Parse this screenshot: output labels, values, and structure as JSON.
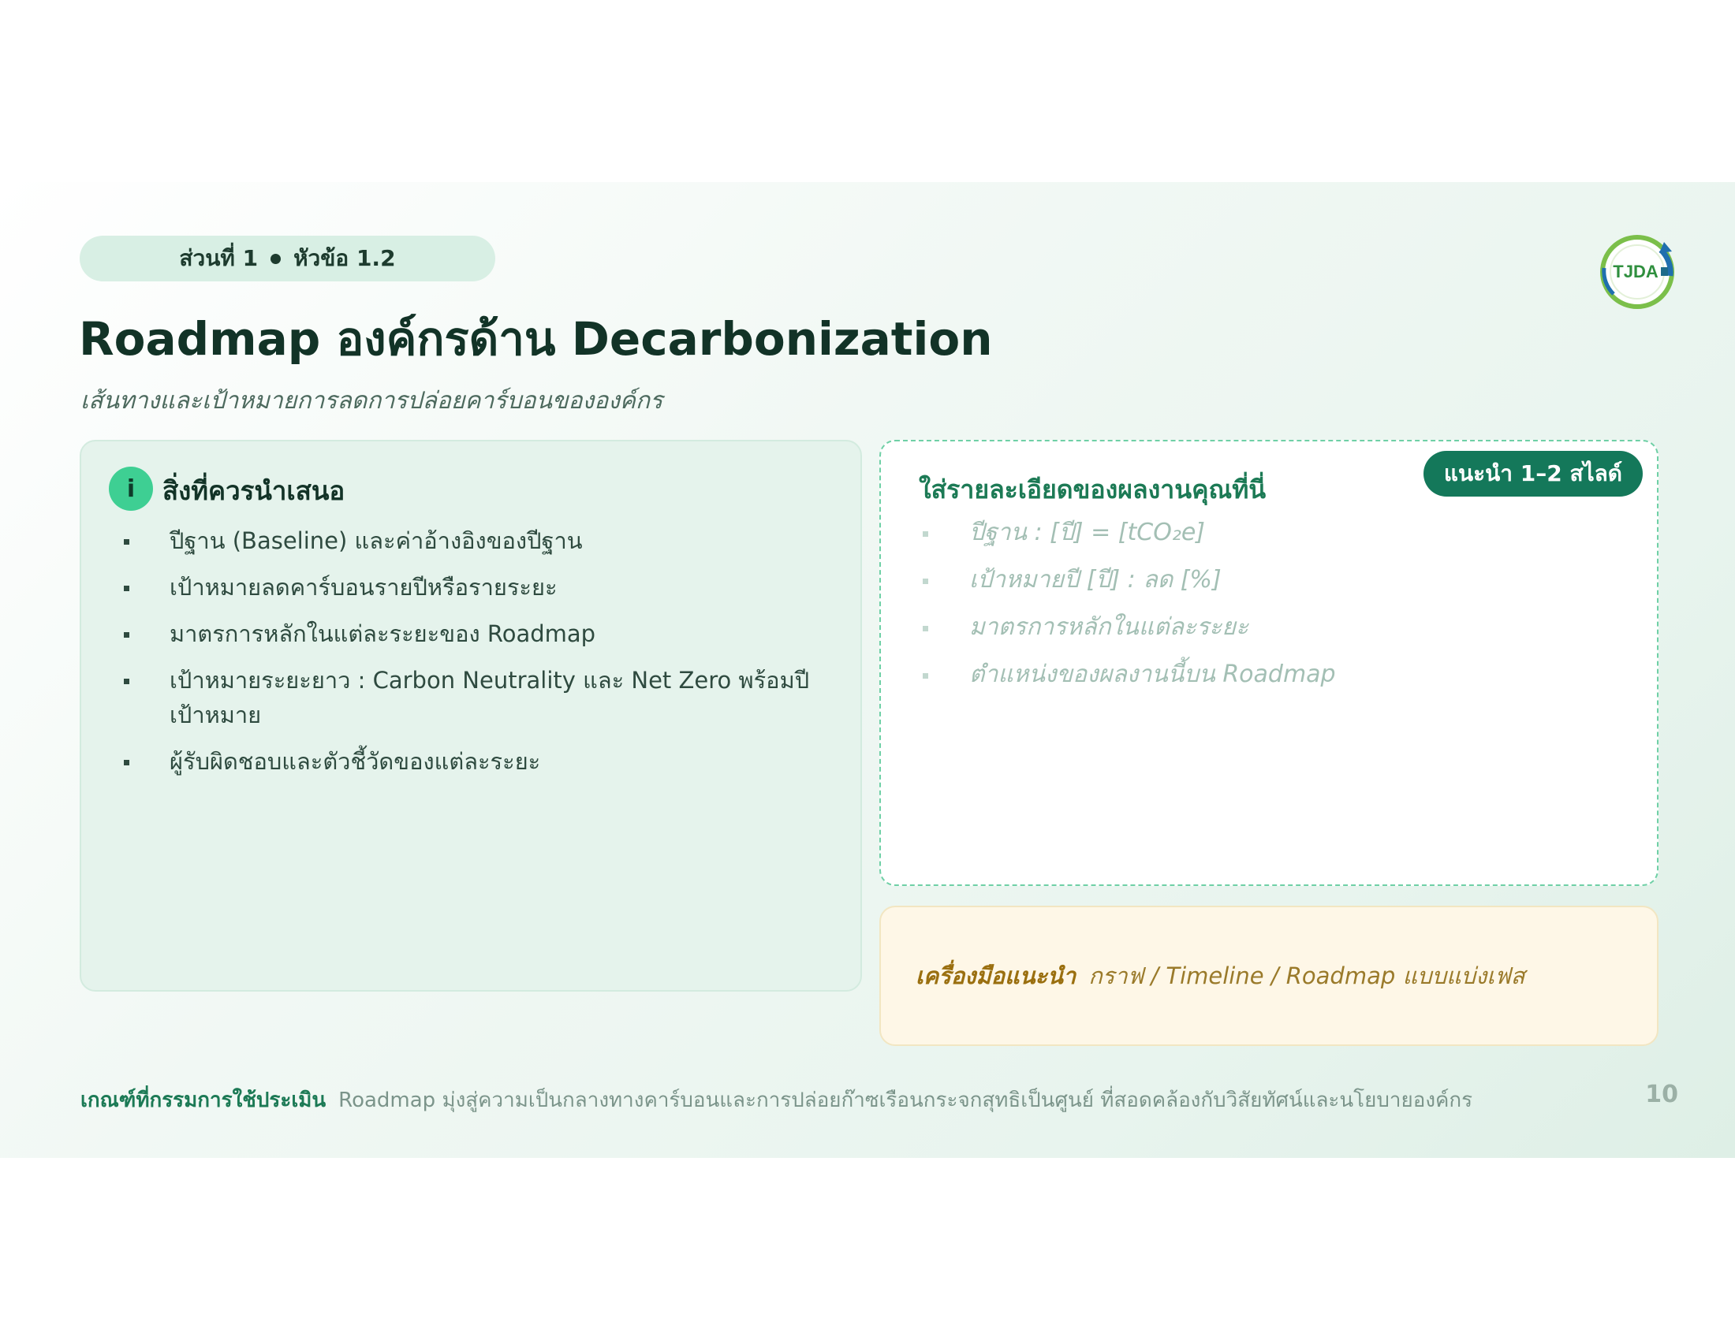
{
  "header": {
    "section_label": "ส่วนที่ 1",
    "topic_label": "หัวข้อ 1.2",
    "logo_text": "TJDA"
  },
  "title": "Roadmap องค์กรด้าน Decarbonization",
  "subtitle": "เส้นทางและเป้าหมายการลดการปล่อยคาร์บอนขององค์กร",
  "left_card": {
    "icon": "info-icon",
    "icon_glyph": "i",
    "heading": "สิ่งที่ควรนำเสนอ",
    "items": [
      "ปีฐาน (Baseline) และค่าอ้างอิงของปีฐาน",
      "เป้าหมายลดคาร์บอนรายปีหรือรายระยะ",
      "มาตรการหลักในแต่ละระยะของ Roadmap",
      "เป้าหมายระยะยาว : Carbon Neutrality และ Net Zero พร้อมปีเป้าหมาย",
      "ผู้รับผิดชอบและตัวชี้วัดของแต่ละระยะ"
    ]
  },
  "right_card": {
    "heading": "ใส่รายละเอียดของผลงานคุณที่นี่",
    "badge": "แนะนำ 1–2 สไลด์",
    "placeholders": [
      "ปีฐาน : [ปี] = [tCO₂e]",
      "เป้าหมายปี [ปี] : ลด [%]",
      "มาตรการหลักในแต่ละระยะ",
      "ตำแหน่งของผลงานนี้บน Roadmap"
    ]
  },
  "tool_card": {
    "label": "เครื่องมือแนะนำ",
    "text": "กราฟ / Timeline / Roadmap แบบแบ่งเฟส"
  },
  "footer": {
    "label": "เกณฑ์ที่กรรมการใช้ประเมิน",
    "text": "Roadmap มุ่งสู่ความเป็นกลางทางคาร์บอนและการปล่อยก๊าซเรือนกระจกสุทธิเป็นศูนย์ ที่สอดคล้องกับวิสัยทัศน์และนโยบายองค์กร",
    "page_number": "10"
  },
  "colors": {
    "brand_dark": "#123327",
    "accent_green": "#14785a",
    "light_mint": "#e5f3ec",
    "gold": "#9a6f0f"
  }
}
